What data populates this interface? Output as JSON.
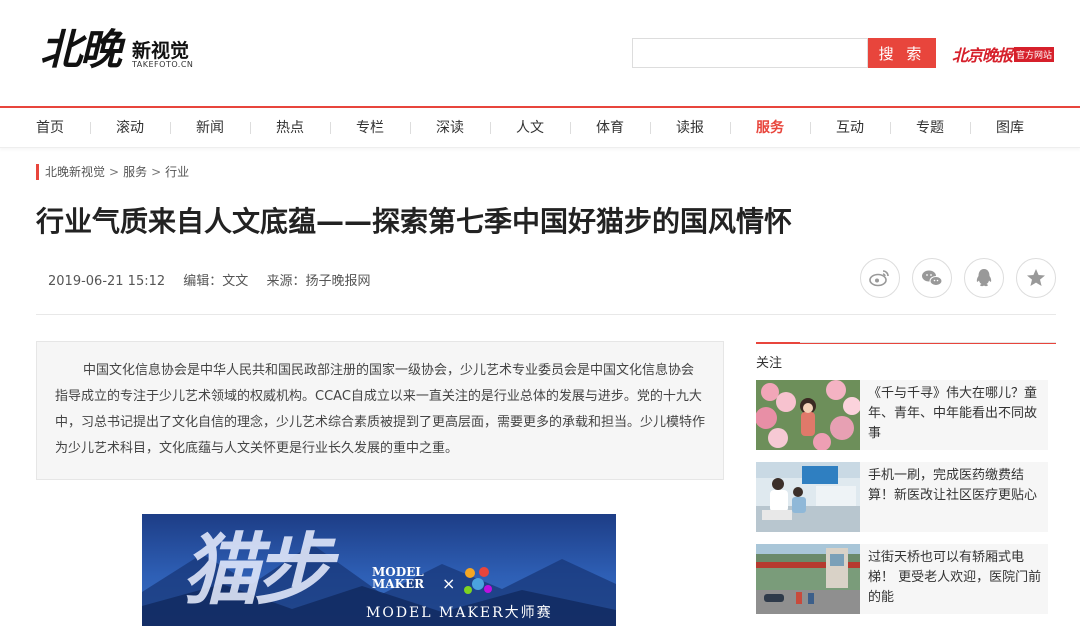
{
  "header": {
    "logo_main": "北晚",
    "logo_sub": "新视觉",
    "logo_domain": "TAKEFOTO.CN",
    "search_placeholder": "",
    "search_button": "搜 索",
    "official_name": "北京晚报",
    "official_tag": "官方网站"
  },
  "nav": {
    "items": [
      "首页",
      "滚动",
      "新闻",
      "热点",
      "专栏",
      "深读",
      "人文",
      "体育",
      "读报",
      "服务",
      "互动",
      "专题",
      "图库"
    ],
    "active": "服务"
  },
  "breadcrumb": {
    "items": [
      "北晚新视觉",
      "服务",
      "行业"
    ],
    "separator": ">"
  },
  "article": {
    "title": "行业气质来自人文底蕴——探索第七季中国好猫步的国风情怀",
    "date": "2019-06-21 15:12",
    "editor": "编辑：文文",
    "source": "来源：扬子晚报网",
    "summary": "中国文化信息协会是中华人民共和国民政部注册的国家一级协会，少儿艺术专业委员会是中国文化信息协会指导成立的专注于少儿艺术领域的权威机构。CCAC自成立以来一直关注的是行业总体的发展与进步。党的十九大中，习总书记提出了文化自信的理念，少儿艺术综合素质被提到了更高层面，需要更多的承载和担当。少儿模特作为少儿艺术科目，文化底蕴与人文关怀更是行业长久发展的重中之重。"
  },
  "share": {
    "icons": [
      "weibo-icon",
      "wechat-icon",
      "qq-icon",
      "favorite-icon"
    ]
  },
  "hero": {
    "logo_line1": "MODEL",
    "logo_line2": "MAKER",
    "x_mark": "×",
    "brand": "MODEL MAKER大师赛"
  },
  "sidebar": {
    "label": "关注",
    "items": [
      {
        "text": "《千与千寻》伟大在哪儿？童年、青年、中年能看出不同故事"
      },
      {
        "text": "手机一刷，完成医药缴费结算！新医改让社区医疗更贴心"
      },
      {
        "text": "过街天桥也可以有轿厢式电梯！ 更受老人欢迎，医院门前的能"
      }
    ]
  },
  "colors": {
    "accent": "#e8453c",
    "brand_red": "#d6202b",
    "summary_bg": "#f6f6f6"
  }
}
